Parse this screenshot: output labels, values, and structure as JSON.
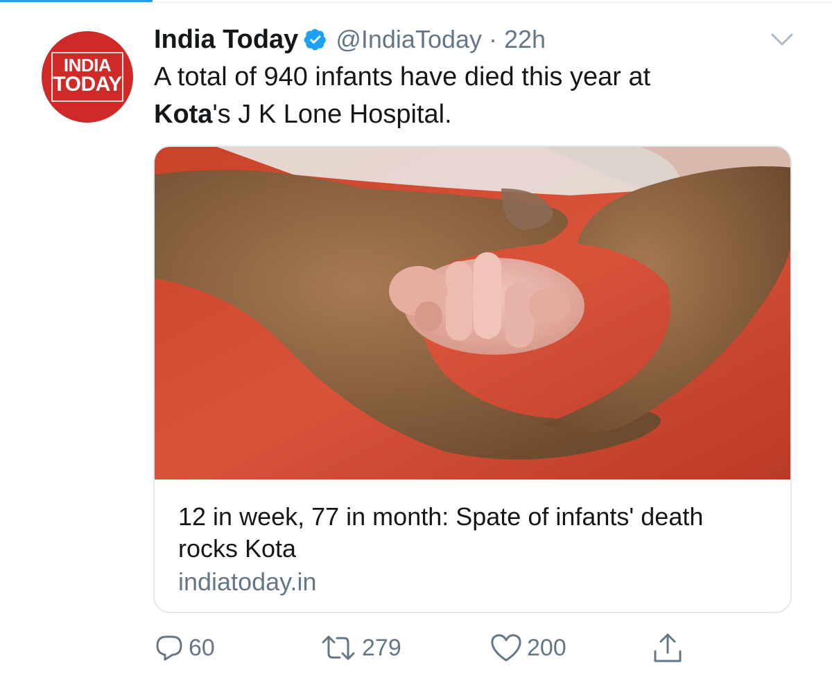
{
  "tweet": {
    "author": {
      "display_name": "India Today",
      "handle": "@IndiaToday",
      "verified": true,
      "avatar_logo_line1": "INDIA",
      "avatar_logo_line2": "TODAY"
    },
    "separator": "·",
    "time": "22h",
    "text": {
      "line1": "A total of 940 infants have died this year at",
      "bold_word": "Kota",
      "line2_rest": "'s J K Lone Hospital."
    },
    "card": {
      "title": "12 in week, 77 in month: Spate of infants' death rocks Kota",
      "domain": "indiatoday.in"
    },
    "actions": {
      "replies": "60",
      "retweets": "279",
      "likes": "200"
    }
  },
  "colors": {
    "accent": "#1da1f2",
    "avatar_bg": "#cf2a27",
    "secondary_text": "#657786",
    "border": "#e1e8ed"
  },
  "icons": {
    "verified": "verified-badge-icon",
    "menu": "chevron-down-icon",
    "reply": "reply-icon",
    "retweet": "retweet-icon",
    "like": "heart-icon",
    "share": "share-icon"
  }
}
